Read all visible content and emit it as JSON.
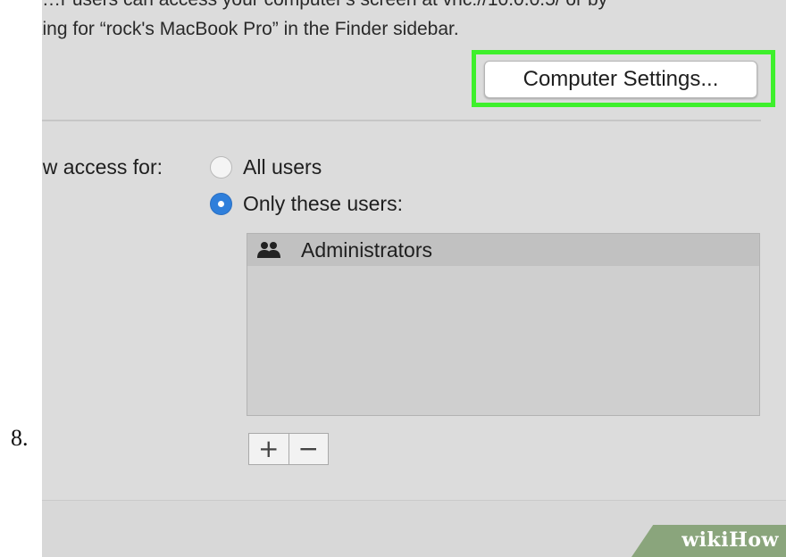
{
  "step_number": "8.",
  "caption": {
    "line_cut": "…r users can access your computer's screen at vnc://10.0.0.5/ or by",
    "line": "king for “rock's MacBook Pro” in the Finder sidebar."
  },
  "toolbar": {
    "computer_settings_label": "Computer Settings..."
  },
  "access": {
    "label": "ow access for:",
    "options": [
      {
        "label": "All users",
        "selected": false
      },
      {
        "label": "Only these users:",
        "selected": true
      }
    ]
  },
  "user_list": {
    "rows": [
      {
        "icon": "group-icon",
        "label": "Administrators"
      }
    ]
  },
  "stepper": {
    "add_label": "+",
    "remove_label": "−"
  },
  "watermark": {
    "text": "wikiHow",
    "color": "#8aa57c"
  },
  "colors": {
    "highlight": "#3ef02c",
    "radio_selected": "#2f7fdb",
    "panel_bg": "#dcdcdc"
  }
}
